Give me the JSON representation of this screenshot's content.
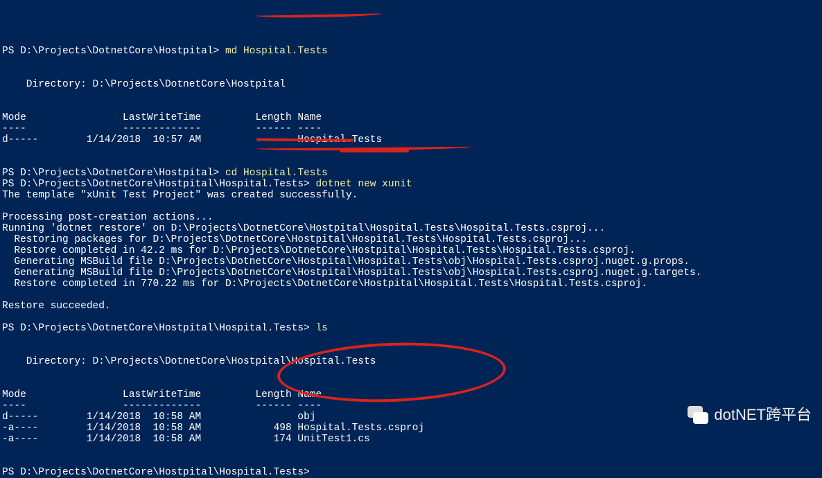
{
  "lines": {
    "l01a": "PS D:\\Projects\\DotnetCore\\Hostpital> ",
    "l01b": "md Hospital.Tests",
    "l02": "",
    "l03": "",
    "l04": "    Directory: D:\\Projects\\DotnetCore\\Hostpital",
    "l05": "",
    "l06": "",
    "l07": "Mode                LastWriteTime         Length Name",
    "l08": "----                -------------         ------ ----",
    "l09": "d-----        1/14/2018  10:57 AM                Hospital.Tests",
    "l10": "",
    "l11": "",
    "l12a": "PS D:\\Projects\\DotnetCore\\Hostpital> ",
    "l12b": "cd Hospital.Tests",
    "l13a": "PS D:\\Projects\\DotnetCore\\Hostpital\\Hospital.Tests> ",
    "l13b": "dotnet new xunit",
    "l14": "The template \"xUnit Test Project\" was created successfully.",
    "l15": "",
    "l16": "Processing post-creation actions...",
    "l17": "Running 'dotnet restore' on D:\\Projects\\DotnetCore\\Hostpital\\Hospital.Tests\\Hospital.Tests.csproj...",
    "l18": "  Restoring packages for D:\\Projects\\DotnetCore\\Hostpital\\Hospital.Tests\\Hospital.Tests.csproj...",
    "l19": "  Restore completed in 42.2 ms for D:\\Projects\\DotnetCore\\Hostpital\\Hospital.Tests\\Hospital.Tests.csproj.",
    "l20": "  Generating MSBuild file D:\\Projects\\DotnetCore\\Hostpital\\Hospital.Tests\\obj\\Hospital.Tests.csproj.nuget.g.props.",
    "l21": "  Generating MSBuild file D:\\Projects\\DotnetCore\\Hostpital\\Hospital.Tests\\obj\\Hospital.Tests.csproj.nuget.g.targets.",
    "l22": "  Restore completed in 770.22 ms for D:\\Projects\\DotnetCore\\Hostpital\\Hospital.Tests\\Hospital.Tests.csproj.",
    "l23": "",
    "l24": "Restore succeeded.",
    "l25": "",
    "l26a": "PS D:\\Projects\\DotnetCore\\Hostpital\\Hospital.Tests> ",
    "l26b": "ls",
    "l27": "",
    "l28": "",
    "l29": "    Directory: D:\\Projects\\DotnetCore\\Hostpital\\Hospital.Tests",
    "l30": "",
    "l31": "",
    "l32": "Mode                LastWriteTime         Length Name",
    "l33": "----                -------------         ------ ----",
    "l34": "d-----        1/14/2018  10:58 AM                obj",
    "l35": "-a----        1/14/2018  10:58 AM            498 Hospital.Tests.csproj",
    "l36": "-a----        1/14/2018  10:58 AM            174 UnitTest1.cs",
    "l37": "",
    "l38": "",
    "l39a": "PS D:\\Projects\\DotnetCore\\Hostpital\\Hospital.Tests>",
    "l39b": " "
  },
  "watermark_text": "dotNET跨平台"
}
